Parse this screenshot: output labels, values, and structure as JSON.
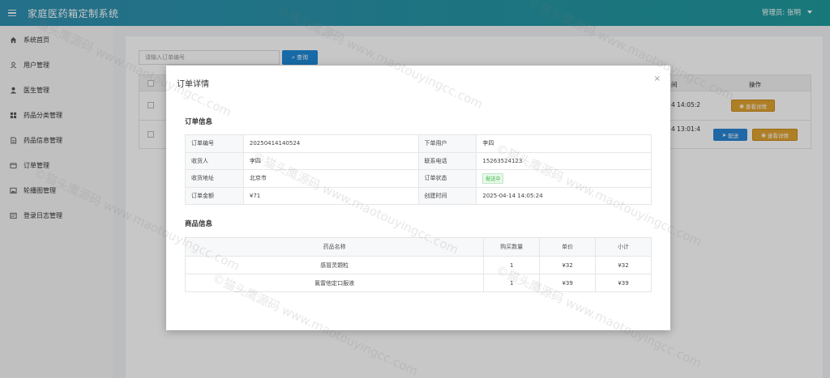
{
  "header": {
    "title": "家庭医药箱定制系统",
    "admin_label": "管理员: 张明"
  },
  "sidebar": {
    "items": [
      {
        "label": "系统首页",
        "icon": "home-icon"
      },
      {
        "label": "用户管理",
        "icon": "user-icon"
      },
      {
        "label": "医生管理",
        "icon": "doctor-icon"
      },
      {
        "label": "药品分类管理",
        "icon": "grid-icon"
      },
      {
        "label": "药品信息管理",
        "icon": "document-icon"
      },
      {
        "label": "订单管理",
        "icon": "order-icon"
      },
      {
        "label": "轮播图管理",
        "icon": "image-icon"
      },
      {
        "label": "登录日志管理",
        "icon": "log-icon"
      }
    ]
  },
  "main": {
    "search_placeholder": "请输入订单编号",
    "search_button": "查询",
    "col_time": "间",
    "col_op": "操作",
    "rows": [
      {
        "time": "4 14:05:2",
        "detail_button": "查看详情"
      },
      {
        "time": "4 13:01:4",
        "ship_button": "配送",
        "detail_button": "查看详情"
      }
    ]
  },
  "modal": {
    "title": "订单详情",
    "close": "×",
    "order_section": "订单信息",
    "goods_section": "商品信息",
    "order_info": {
      "order_no_label": "订单编号",
      "order_no": "20250414140524",
      "user_label": "下单用户",
      "user": "李四",
      "receiver_label": "收货人",
      "receiver": "李四",
      "phone_label": "联系电话",
      "phone": "15263524123",
      "address_label": "收货地址",
      "address": "北京市",
      "status_label": "订单状态",
      "status": "配送中",
      "amount_label": "订单金额",
      "amount": "¥71",
      "created_label": "创建时间",
      "created": "2025-04-14 14:05:24"
    },
    "goods_headers": [
      "药品名称",
      "购买数量",
      "单价",
      "小计"
    ],
    "goods_rows": [
      {
        "name": "感冒灵颗粒",
        "qty": "1",
        "price": "¥32",
        "subtotal": "¥32"
      },
      {
        "name": "氯雷他定口服液",
        "qty": "1",
        "price": "¥39",
        "subtotal": "¥39"
      }
    ]
  },
  "watermark": "©猫头鹰源码 www.maotouyingcc.com",
  "colors": {
    "header_start": "#2f8fb1",
    "header_end": "#1f9a9c",
    "primary_button": "#1e88d6",
    "detail_button": "#e0a331",
    "status_green": "#39b54a"
  }
}
